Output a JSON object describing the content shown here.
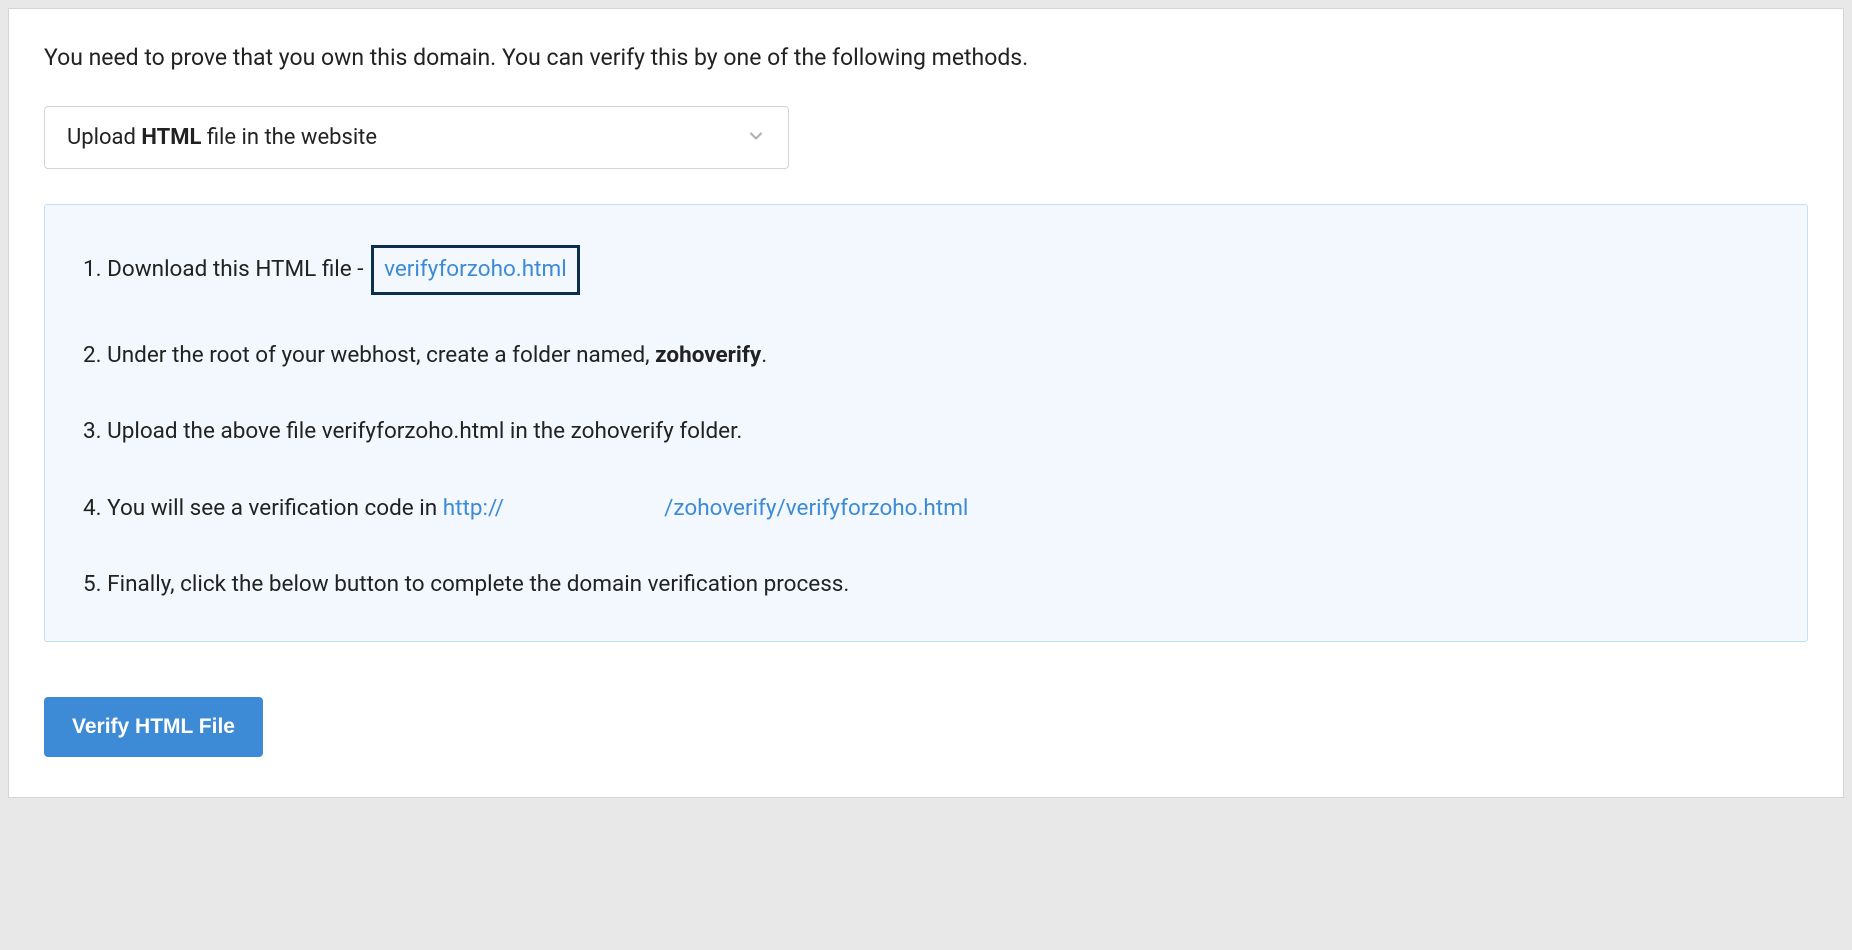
{
  "intro": "You need to prove that you own this domain. You can verify this by one of the following methods.",
  "dropdown": {
    "prefix": "Upload ",
    "bold": "HTML",
    "suffix": " file in the website"
  },
  "instructions": {
    "step1_prefix": "1. Download this HTML file - ",
    "step1_file": "verifyforzoho.html",
    "step2_prefix": "2. Under the root of your webhost, create a folder named, ",
    "step2_bold": "zohoverify",
    "step2_suffix": ".",
    "step3": "3. Upload the above file verifyforzoho.html in the zohoverify folder.",
    "step4_prefix": "4. You will see a verification code in ",
    "step4_link_a": "http://",
    "step4_link_b": "/zohoverify/verifyforzoho.html",
    "step5": "5. Finally, click the below button to complete the domain verification process."
  },
  "button": {
    "label": "Verify HTML File"
  }
}
